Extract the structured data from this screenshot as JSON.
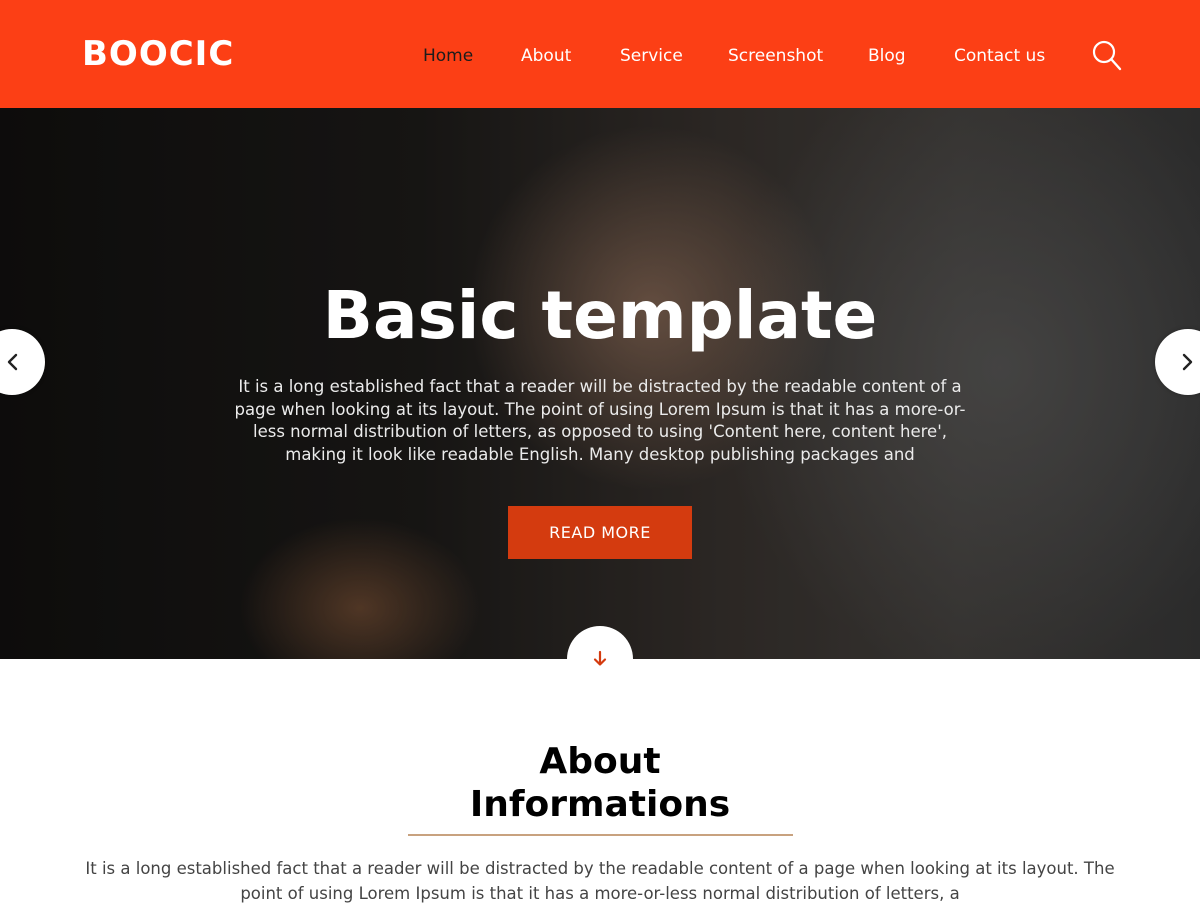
{
  "brand": {
    "logo": "BOOCIC",
    "accent": "#fc3f15",
    "button_color": "#d43b0f"
  },
  "nav": {
    "items": [
      {
        "label": "Home",
        "active": true
      },
      {
        "label": "About"
      },
      {
        "label": "Service"
      },
      {
        "label": "Screenshot"
      },
      {
        "label": "Blog"
      },
      {
        "label": "Contact us"
      }
    ],
    "search_icon": "search-icon"
  },
  "hero": {
    "title": "Basic template",
    "text": "It is a long established fact that a reader will be distracted by the readable content of a page when looking at its layout. The point of using Lorem Ipsum is that it has a more-or-less normal distribution of letters, as opposed to using 'Content here, content here', making it look like readable English. Many desktop publishing packages and",
    "button": "READ MORE",
    "prev_icon": "chevron-left-icon",
    "next_icon": "chevron-right-icon",
    "scroll_icon": "arrow-down-icon"
  },
  "about": {
    "title": "About Informations",
    "text": "It is a long established fact that a reader will be distracted by the readable content of a page when looking at its layout. The point of using Lorem Ipsum is that it has a more-or-less normal distribution of letters, a"
  }
}
